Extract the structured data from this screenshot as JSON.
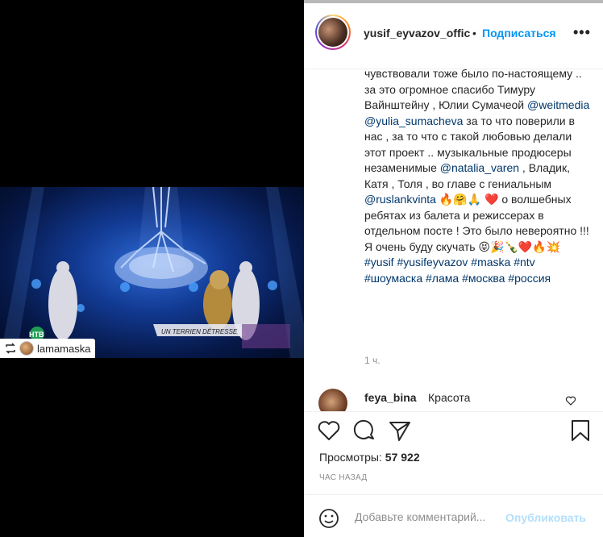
{
  "media": {
    "overlay_text": "UN TERRIEN DÉTRESSE",
    "channel_logo": "НТВ",
    "repost": {
      "username": "lamamaska"
    }
  },
  "header": {
    "username": "yusif_eyvazov_offic",
    "dot": "•",
    "follow_label": "Подписаться",
    "more_label": "•••"
  },
  "caption": {
    "segments": [
      {
        "t": "чувствовали тоже было по-настоящему .. за это огромное спасибо Тимуру Вайнштейну , Юлии Сумачеой "
      },
      {
        "t": "@weitmedia",
        "m": true
      },
      {
        "t": " "
      },
      {
        "t": "@yulia_sumacheva",
        "m": true
      },
      {
        "t": " за то что поверили в нас , за то что с такой любовью делали этот проект .. музыкальные продюсеры незаменимые "
      },
      {
        "t": "@natalia_varen",
        "m": true
      },
      {
        "t": " , Владик, Катя , Толя , во главе с гениальным "
      },
      {
        "t": "@ruslankvinta",
        "m": true
      },
      {
        "t": " 🔥🤗🙏 ❤️ о волшебных ребятах из балета и режиссерах в отдельном посте ! Это было невероятно !!! Я очень буду скучать 😝🎉🍾❤️🔥💥 "
      },
      {
        "t": "#yusif",
        "m": true
      },
      {
        "t": " "
      },
      {
        "t": "#yusifeyvazov",
        "m": true
      },
      {
        "t": " "
      },
      {
        "t": "#maska",
        "m": true
      },
      {
        "t": " "
      },
      {
        "t": "#ntv",
        "m": true
      },
      {
        "t": " "
      },
      {
        "t": "#шоумаска",
        "m": true
      },
      {
        "t": " "
      },
      {
        "t": "#лама",
        "m": true
      },
      {
        "t": " "
      },
      {
        "t": "#москва",
        "m": true
      },
      {
        "t": " "
      },
      {
        "t": "#россия",
        "m": true
      }
    ],
    "time": "1 ч."
  },
  "comment": {
    "username": "feya_bina",
    "text": "Красота"
  },
  "actions": {
    "views_label": "Просмотры:",
    "views_count": "57 922",
    "time_ago": "ЧАС НАЗАД",
    "comment_placeholder": "Добавьте комментарий...",
    "publish_label": "Опубликовать"
  },
  "icons": {
    "like": "heart-icon",
    "comment": "comment-icon",
    "share": "share-icon",
    "save": "bookmark-icon",
    "emoji": "emoji-icon",
    "repost": "repost-icon"
  },
  "colors": {
    "accent": "#0095f6",
    "mention": "#00376b",
    "publish_disabled": "#b2dffc",
    "muted": "#8e8e8e"
  }
}
